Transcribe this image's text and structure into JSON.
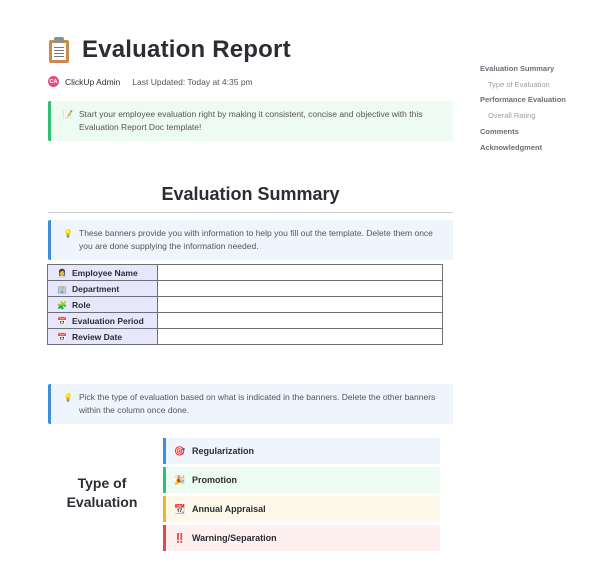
{
  "doc": {
    "title_icon": "clipboard-icon",
    "title": "Evaluation Report",
    "author_initials": "CA",
    "author": "ClickUp Admin",
    "last_updated": "Last Updated: Today at 4:35 pm"
  },
  "intro_banner": {
    "icon": "memo-icon",
    "text": "Start your employee evaluation right by making it consistent, concise and objective with this Evaluation Report Doc template!"
  },
  "summary": {
    "heading": "Evaluation Summary",
    "banner": {
      "icon": "lightbulb-icon",
      "text": "These banners provide you with information to help you fill out the template. Delete them once you are done supplying the information needed."
    },
    "table": [
      {
        "icon": "👩‍💼",
        "label": "Employee Name",
        "value": ""
      },
      {
        "icon": "🏢",
        "label": "Department",
        "value": ""
      },
      {
        "icon": "🧩",
        "label": "Role",
        "value": ""
      },
      {
        "icon": "📅",
        "label": "Evaluation Period",
        "value": ""
      },
      {
        "icon": "📅",
        "label": "Review Date",
        "value": ""
      }
    ]
  },
  "evaluation": {
    "banner": {
      "icon": "lightbulb-icon",
      "text": "Pick the type of evaluation based on what is indicated in the banners. Delete the other banners within the column once done."
    },
    "label": "Type of Evaluation",
    "options": [
      {
        "icon": "🎯",
        "label": "Regularization",
        "color": "#3e8ede"
      },
      {
        "icon": "🎉",
        "label": "Promotion",
        "color": "#2fbf71"
      },
      {
        "icon": "📆",
        "label": "Annual Appraisal",
        "color": "#f0b429"
      },
      {
        "icon": "‼️",
        "label": "Warning/Separation",
        "color": "#e5484d"
      }
    ]
  },
  "toc": [
    {
      "label": "Evaluation Summary",
      "level": 1
    },
    {
      "label": "Type of Evaluation",
      "level": 2
    },
    {
      "label": "Performance Evaluation",
      "level": 1
    },
    {
      "label": "Overall Rating",
      "level": 2
    },
    {
      "label": "Comments",
      "level": 1
    },
    {
      "label": "Acknowledgment",
      "level": 1
    }
  ]
}
